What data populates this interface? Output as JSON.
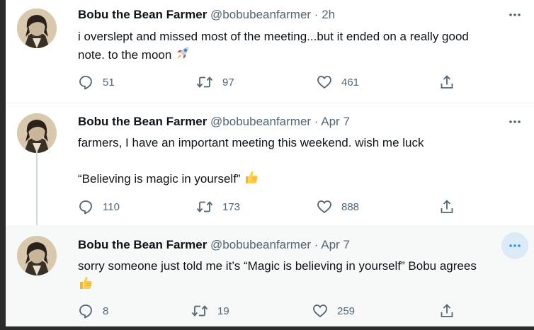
{
  "tweets": [
    {
      "name": "Bobu the Bean Farmer",
      "handle": "@bobubeanfarmer",
      "dot": "·",
      "time": "2h",
      "text_line1": "i overslept and missed most of the meeting...but it ended on a really good",
      "text_line2": "note. to the moon",
      "emoji": "rocket",
      "reply_count": "51",
      "retweet_count": "97",
      "like_count": "461"
    },
    {
      "name": "Bobu the Bean Farmer",
      "handle": "@bobubeanfarmer",
      "dot": "·",
      "time": "Apr 7",
      "text_line1": "farmers, I have an important meeting this weekend. wish me luck",
      "text_line2": "“Believing is magic in yourself”",
      "emoji": "thumbs-up",
      "reply_count": "110",
      "retweet_count": "173",
      "like_count": "888"
    },
    {
      "name": "Bobu the Bean Farmer",
      "handle": "@bobubeanfarmer",
      "dot": "·",
      "time": "Apr 7",
      "text_line1": "sorry someone just told me it’s “Magic is believing in yourself” Bobu agrees",
      "emoji": "thumbs-up",
      "reply_count": "8",
      "retweet_count": "19",
      "like_count": "259"
    }
  ],
  "icons": {
    "more": "more-horizontal-icon",
    "reply": "reply-icon",
    "retweet": "retweet-icon",
    "like": "heart-icon",
    "share": "share-icon"
  },
  "colors": {
    "text": "#0f1419",
    "secondary": "#536471",
    "hover_bg": "#f7f9f9",
    "more_hover": "#dbeaf6"
  }
}
